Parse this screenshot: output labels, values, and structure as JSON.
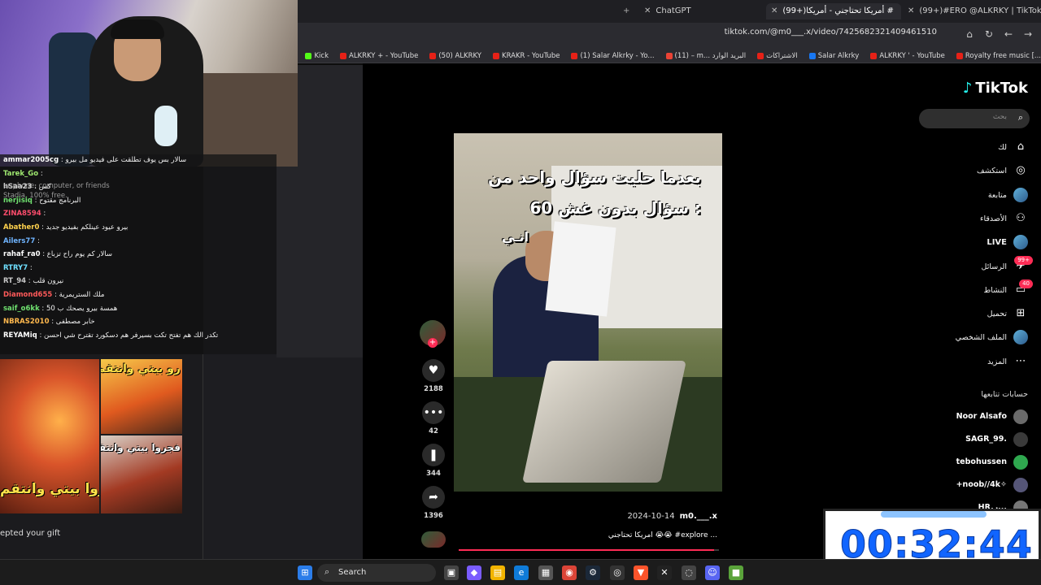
{
  "browser": {
    "tabs": [
      {
        "label": "ChatGPT"
      },
      {
        "label": "(99+)أمريكا تحتاجني - أمريكا #"
      },
      {
        "label": "(99+)#ERO @ALKRKY | TikTok"
      }
    ],
    "url": "tiktok.com/@m0___.x/video/7425682321409461510",
    "bookmarks": [
      {
        "label": "Royalty free music [...",
        "color": "#e62117"
      },
      {
        "label": "ALKRKY ' - YouTube",
        "color": "#e62117"
      },
      {
        "label": "Salar Alkrky",
        "color": "#1877f2"
      },
      {
        "label": "الاشتراكات",
        "color": "#e62117"
      },
      {
        "label": "(11) – m... البريد الوارد",
        "color": "#ea4335"
      },
      {
        "label": "(1) Salar Alkrky - Yo...",
        "color": "#e62117"
      },
      {
        "label": "KRAKR - YouTube",
        "color": "#e62117"
      },
      {
        "label": "(50) ALKRKY",
        "color": "#e62117"
      },
      {
        "label": "ALKRKY + - YouTube",
        "color": "#e62117"
      },
      {
        "label": "Kick",
        "color": "#53fc18"
      }
    ]
  },
  "chat": {
    "messages": [
      {
        "user": "ammar2005cg",
        "text": ": سالار بس يوف تطلقت على فيديو مل بيرو",
        "color": "#ffffff"
      },
      {
        "user": "Tarek_Go",
        "text": ":",
        "color": "#9fe870"
      },
      {
        "user": "hSaa23",
        "text": ": كس",
        "color": "#c9c9c9"
      },
      {
        "user": "nerjisiq",
        "text": ": البرنامج مقتوح",
        "color": "#6fe06f"
      },
      {
        "user": "ZINA8594",
        "text": ":",
        "color": "#ff4d6d"
      },
      {
        "user": "Abather0",
        "text": ": بيرو عيود عينلكم بفيديو جديد",
        "color": "#ffd24d"
      },
      {
        "user": "Ailers77",
        "text": ":",
        "color": "#6fb4ff"
      },
      {
        "user": "rahaf_ra0",
        "text": ": سالار كم يوم راح تزباع",
        "color": "#ffffff"
      },
      {
        "user": "RTRY7",
        "text": ":",
        "color": "#6fe0ff"
      },
      {
        "user": "RT_94",
        "text": ": نيرون قلب",
        "color": "#c9c9c9"
      },
      {
        "user": "Diamond655",
        "text": ": ملك الستريمرية",
        "color": "#ff5a5a"
      },
      {
        "user": "saif_o6kk",
        "text": ": همسة بيرو يصحك ب 50",
        "color": "#6fe06f"
      },
      {
        "user": "NBRAS2010",
        "text": ": خابر مصطفى",
        "color": "#ffb84d"
      },
      {
        "user": "REYAMiq",
        "text": ": تكدر الك هم تفتح تكت بسيرفر هم دسكورد تقترح شي احسن",
        "color": "#ffffff"
      }
    ],
    "ghost": {
      "line1": "ur phone, computer, or friends",
      "line2": "Stadia, 100% free."
    },
    "gift": "epted your gift"
  },
  "thumbs": {
    "a_text": "حروا بيتي وانتقم",
    "b_text": "رو بيتي وانتقمت",
    "c_text": "فجروا بيتي وانتقمت"
  },
  "tiktok": {
    "logo": "TikTok",
    "search_placeholder": "بحث",
    "nav": [
      {
        "label": "لك",
        "icon": "home-icon",
        "glyph": "⌂"
      },
      {
        "label": "استكشف",
        "icon": "compass-icon",
        "glyph": "◎"
      },
      {
        "label": "متابعة",
        "icon": "following-avatar",
        "glyph": ""
      },
      {
        "label": "الأصدقاء",
        "icon": "friends-icon",
        "glyph": "⚇"
      },
      {
        "label": "LIVE",
        "icon": "live-avatar",
        "glyph": ""
      },
      {
        "label": "الرسائل",
        "icon": "messages-icon",
        "glyph": "✈",
        "badge": "99+"
      },
      {
        "label": "النشاط",
        "icon": "activity-icon",
        "glyph": "▭",
        "badge": "40"
      },
      {
        "label": "تحميل",
        "icon": "upload-icon",
        "glyph": "⊞"
      },
      {
        "label": "الملف الشخصي",
        "icon": "profile-avatar",
        "glyph": ""
      },
      {
        "label": "المزيد",
        "icon": "more-icon",
        "glyph": "⋯"
      }
    ],
    "following_title": "حسابات تتابعها",
    "following": [
      {
        "name": "Noor Alsafo",
        "color": "#6a6a6a"
      },
      {
        "name": "SAGR_99.",
        "color": "#3a3a3a"
      },
      {
        "name": "tebohussen",
        "color": "#2fa84f"
      },
      {
        "name": "+noob//4k✧",
        "color": "#555577"
      },
      {
        "name": "HR.ر...",
        "color": "#777777"
      }
    ],
    "video": {
      "caption_line1": "بعدما حليت سؤال واحد من",
      "caption_line2": "60 سؤال بدون غش :",
      "caption_line3": "انـي",
      "date": "2024-10-14",
      "handle": "m0.___.x",
      "description": "امريكا تحتاجني 😭😭 #explore ...",
      "progress": 0.98
    },
    "actions": [
      {
        "name": "like",
        "glyph": "♥",
        "count": "2188"
      },
      {
        "name": "comment",
        "glyph": "•••",
        "count": "42"
      },
      {
        "name": "bookmark",
        "glyph": "❚",
        "count": "344"
      },
      {
        "name": "share",
        "glyph": "➦",
        "count": "1396"
      }
    ]
  },
  "timer": {
    "value": "00:32:44"
  },
  "taskbar": {
    "search_label": "Search"
  }
}
